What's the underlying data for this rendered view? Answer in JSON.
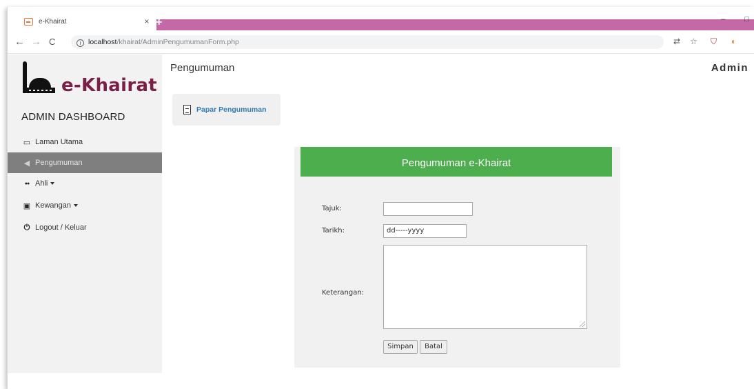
{
  "browser": {
    "tab_title": "e-Khairat",
    "tab_close": "×",
    "new_tab": "+",
    "window_controls": {
      "minimize": "–",
      "maximize": "□"
    },
    "nav": {
      "back": "←",
      "forward": "→",
      "reload": "C"
    },
    "url_host": "localhost",
    "url_path": "/khairat/AdminPengumumanForm.php",
    "info": "i",
    "translate": "⇄",
    "star": "☆",
    "extension": "⛉",
    "profile": "◐",
    "accent_color": "#c468a6"
  },
  "sidebar": {
    "logo_text": "e-Khairat",
    "logo_color": "#7a1f47",
    "dashboard_title": "ADMIN DASHBOARD",
    "items": [
      {
        "label": "Laman Utama",
        "icon": "monitor-icon",
        "glyph": "▭"
      },
      {
        "label": "Pengumuman",
        "icon": "bullhorn-icon",
        "glyph": "◀"
      },
      {
        "label": "Ahli",
        "icon": "users-icon",
        "glyph": "●●"
      },
      {
        "label": "Kewangan",
        "icon": "finance-icon",
        "glyph": "▣"
      },
      {
        "label": "Logout / Keluar",
        "icon": "power-icon",
        "glyph": "⏻"
      }
    ]
  },
  "main": {
    "heading": "Pengumuman",
    "user": "Admin",
    "papar_button": "Papar Pengumuman",
    "form": {
      "title": "Pengumuman e-Khairat",
      "header_color": "#4cae4c",
      "tajuk_label": "Tajuk:",
      "tajuk_value": "",
      "tarikh_label": "Tarikh:",
      "tarikh_value": "dd-----yyyy",
      "keterangan_label": "Keterangan:",
      "keterangan_value": "",
      "simpan_label": "Simpan",
      "batal_label": "Batal"
    }
  }
}
